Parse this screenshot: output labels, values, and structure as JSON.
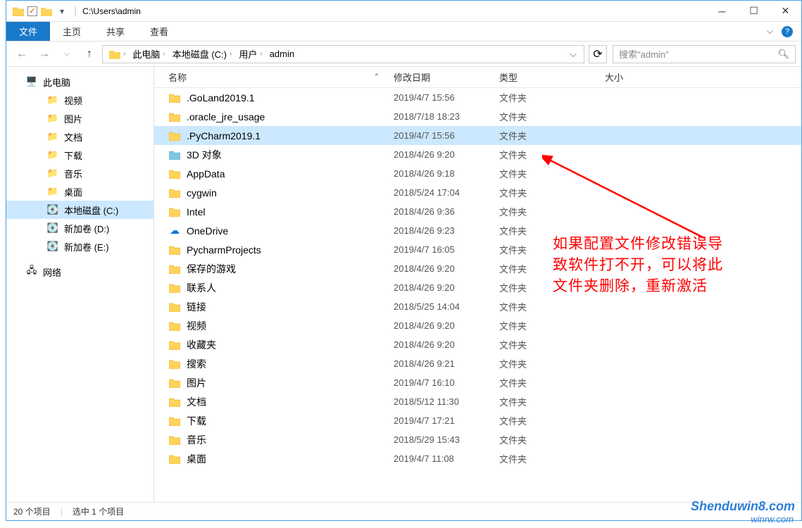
{
  "titlebar": {
    "path": "C:\\Users\\admin"
  },
  "ribbon": {
    "file": "文件",
    "home": "主页",
    "share": "共享",
    "view": "查看"
  },
  "breadcrumb": {
    "items": [
      "此电脑",
      "本地磁盘 (C:)",
      "用户",
      "admin"
    ]
  },
  "search": {
    "placeholder": "搜索\"admin\""
  },
  "sidebar": {
    "this_pc": "此电脑",
    "videos": "视频",
    "pictures": "图片",
    "documents": "文档",
    "downloads": "下载",
    "music": "音乐",
    "desktop": "桌面",
    "local_c": "本地磁盘 (C:)",
    "vol_d": "新加卷 (D:)",
    "vol_e": "新加卷 (E:)",
    "network": "网络"
  },
  "columns": {
    "name": "名称",
    "date": "修改日期",
    "type": "类型",
    "size": "大小"
  },
  "type_folder": "文件夹",
  "files": [
    {
      "name": ".GoLand2019.1",
      "date": "2019/4/7 15:56",
      "type": "文件夹",
      "icon": "folder"
    },
    {
      "name": ".oracle_jre_usage",
      "date": "2018/7/18 18:23",
      "type": "文件夹",
      "icon": "folder"
    },
    {
      "name": ".PyCharm2019.1",
      "date": "2019/4/7 15:56",
      "type": "文件夹",
      "icon": "folder",
      "selected": true
    },
    {
      "name": "3D 对象",
      "date": "2018/4/26 9:20",
      "type": "文件夹",
      "icon": "3d"
    },
    {
      "name": "AppData",
      "date": "2018/4/26 9:18",
      "type": "文件夹",
      "icon": "folder"
    },
    {
      "name": "cygwin",
      "date": "2018/5/24 17:04",
      "type": "文件夹",
      "icon": "folder"
    },
    {
      "name": "Intel",
      "date": "2018/4/26 9:36",
      "type": "文件夹",
      "icon": "folder"
    },
    {
      "name": "OneDrive",
      "date": "2018/4/26 9:23",
      "type": "文件夹",
      "icon": "onedrive"
    },
    {
      "name": "PycharmProjects",
      "date": "2019/4/7 16:05",
      "type": "文件夹",
      "icon": "folder"
    },
    {
      "name": "保存的游戏",
      "date": "2018/4/26 9:20",
      "type": "文件夹",
      "icon": "games"
    },
    {
      "name": "联系人",
      "date": "2018/4/26 9:20",
      "type": "文件夹",
      "icon": "contacts"
    },
    {
      "name": "链接",
      "date": "2018/5/25 14:04",
      "type": "文件夹",
      "icon": "links"
    },
    {
      "name": "视频",
      "date": "2018/4/26 9:20",
      "type": "文件夹",
      "icon": "videos"
    },
    {
      "name": "收藏夹",
      "date": "2018/4/26 9:20",
      "type": "文件夹",
      "icon": "favorites"
    },
    {
      "name": "搜索",
      "date": "2018/4/26 9:21",
      "type": "文件夹",
      "icon": "search"
    },
    {
      "name": "图片",
      "date": "2019/4/7 16:10",
      "type": "文件夹",
      "icon": "pictures"
    },
    {
      "name": "文档",
      "date": "2018/5/12 11:30",
      "type": "文件夹",
      "icon": "documents"
    },
    {
      "name": "下载",
      "date": "2019/4/7 17:21",
      "type": "文件夹",
      "icon": "downloads"
    },
    {
      "name": "音乐",
      "date": "2018/5/29 15:43",
      "type": "文件夹",
      "icon": "music"
    },
    {
      "name": "桌面",
      "date": "2019/4/7 11:08",
      "type": "文件夹",
      "icon": "desktop"
    }
  ],
  "statusbar": {
    "count": "20 个项目",
    "selected": "选中 1 个项目"
  },
  "annotation": {
    "line1": "如果配置文件修改错误导",
    "line2": "致软件打不开，可以将此",
    "line3": "文件夹删除，重新激活"
  },
  "watermark": "Shenduwin8.com",
  "watermark2": "winrw.com"
}
